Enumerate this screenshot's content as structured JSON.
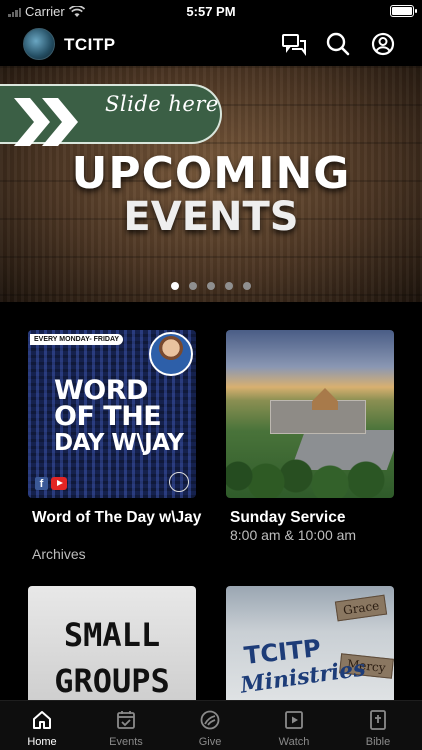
{
  "status_bar": {
    "carrier": "Carrier",
    "time": "5:57 PM"
  },
  "header": {
    "title": "TCITP"
  },
  "banner": {
    "slide_hint": "Slide here",
    "title_line1": "UPCOMING",
    "title_line2": "EVENTS",
    "page_count": 5,
    "active_page": 1
  },
  "cards": [
    {
      "title": "Word of The Day w\\Jay",
      "subtitle": "Archives",
      "thumb": {
        "tag": "EVERY MONDAY- FRIDAY",
        "line1": "WORD",
        "line2": "OF THE",
        "line3": "DAY W\\JAY"
      }
    },
    {
      "title": "Sunday Service",
      "subtitle": "8:00 am  & 10:00 am"
    },
    {
      "thumb": {
        "line1": "SMALL",
        "line2": "GROUPS"
      }
    },
    {
      "thumb": {
        "line1": "TCITP",
        "line2": "Ministries",
        "sign1": "Grace",
        "sign2": "Mercy"
      }
    }
  ],
  "tabs": [
    {
      "label": "Home",
      "icon": "home-icon",
      "active": true
    },
    {
      "label": "Events",
      "icon": "calendar-check-icon",
      "active": false
    },
    {
      "label": "Give",
      "icon": "give-icon",
      "active": false
    },
    {
      "label": "Watch",
      "icon": "play-icon",
      "active": false
    },
    {
      "label": "Bible",
      "icon": "bible-icon",
      "active": false
    }
  ],
  "colors": {
    "tab_active": "#ffffff",
    "tab_inactive": "#8a8a8a",
    "slide_tag": "#3b5f45"
  }
}
